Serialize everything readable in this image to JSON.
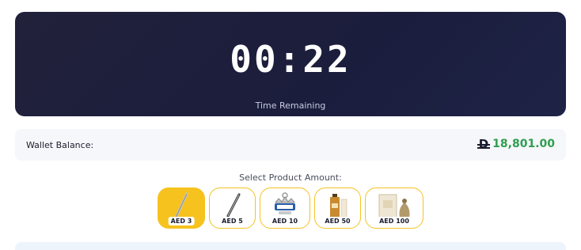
{
  "timer": {
    "value": "00:22",
    "label": "Time Remaining"
  },
  "wallet": {
    "label": "Wallet Balance:",
    "currency_icon": "dirham-icon",
    "amount": "18,801.00",
    "amount_color": "#2e9e4f"
  },
  "products": {
    "label": "Select Product Amount:",
    "items": [
      {
        "label": "AED 3",
        "icon": "pen-icon",
        "selected": true
      },
      {
        "label": "AED 5",
        "icon": "pen-icon",
        "selected": false
      },
      {
        "label": "AED 10",
        "icon": "keychain-icon",
        "selected": false
      },
      {
        "label": "AED 50",
        "icon": "perfume-icon",
        "selected": false
      },
      {
        "label": "AED 100",
        "icon": "gift-set-icon",
        "selected": false
      }
    ]
  },
  "colors": {
    "accent": "#f6c21d",
    "timer_bg": "#1b1d3d"
  }
}
